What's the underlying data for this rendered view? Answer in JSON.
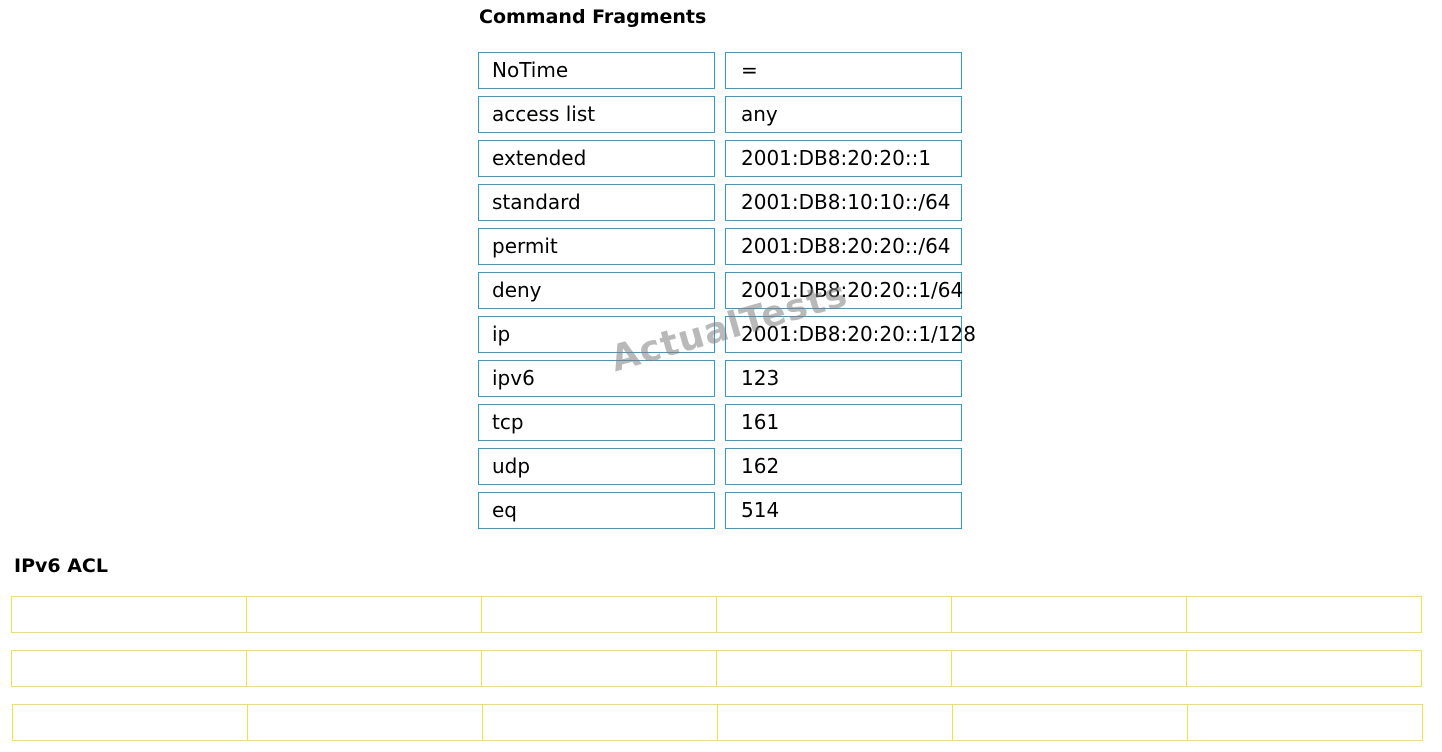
{
  "fragments_section": {
    "title": "Command Fragments",
    "left_column": [
      "NoTime",
      "access list",
      "extended",
      "standard",
      "permit",
      "deny",
      "ip",
      "ipv6",
      "tcp",
      "udp",
      "eq"
    ],
    "right_column": [
      "=",
      "any",
      "2001:DB8:20:20::1",
      "2001:DB8:10:10::/64",
      "2001:DB8:20:20::/64",
      "2001:DB8:20:20::1/64",
      "2001:DB8:20:20::1/128",
      "123",
      "161",
      "162",
      "514"
    ]
  },
  "acl_section": {
    "title": "IPv6 ACL",
    "rows": 3,
    "cells_per_row": 6
  },
  "watermark": "ActualTests",
  "colors": {
    "fragment_border": "#2aa0d2",
    "drop_slot_border": "#f2e24a"
  }
}
